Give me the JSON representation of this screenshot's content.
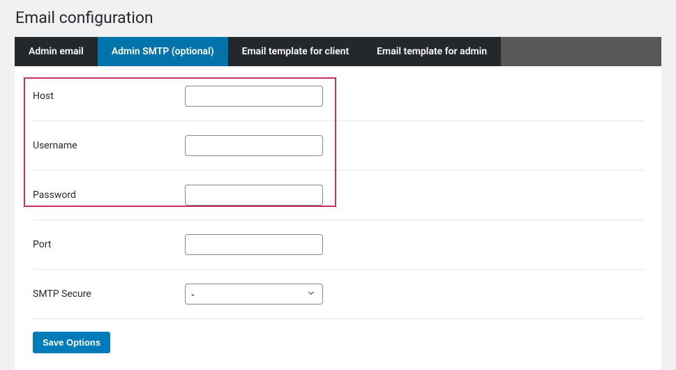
{
  "page_title": "Email configuration",
  "tabs": [
    {
      "label": "Admin email",
      "active": false
    },
    {
      "label": "Admin SMTP (optional)",
      "active": true
    },
    {
      "label": "Email template for client",
      "active": false
    },
    {
      "label": "Email template for admin",
      "active": false
    }
  ],
  "fields": {
    "host": {
      "label": "Host",
      "value": ""
    },
    "username": {
      "label": "Username",
      "value": ""
    },
    "password": {
      "label": "Password",
      "value": ""
    },
    "port": {
      "label": "Port",
      "value": ""
    },
    "smtp_secure": {
      "label": "SMTP Secure",
      "selected": "-",
      "options": [
        "-"
      ]
    }
  },
  "buttons": {
    "save": "Save Options"
  }
}
